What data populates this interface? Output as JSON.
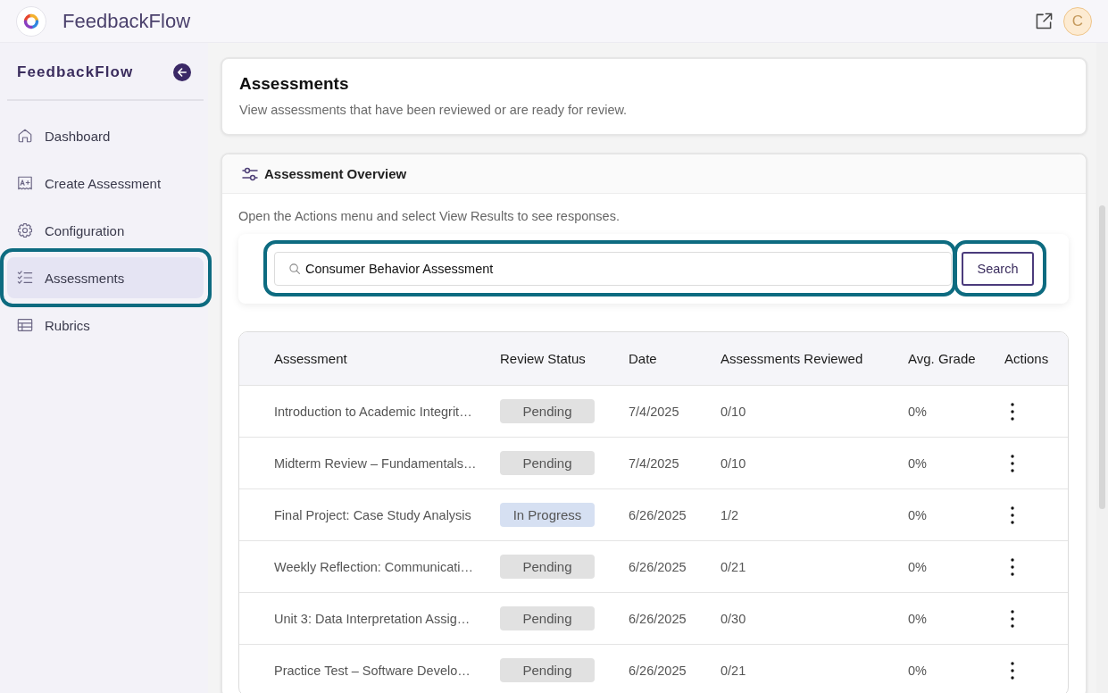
{
  "app_bar": {
    "title": "FeedbackFlow",
    "avatar_initial": "C"
  },
  "sidebar": {
    "title": "FeedbackFlow",
    "items": [
      {
        "label": "Dashboard",
        "kind": "home",
        "selected": false,
        "highlighted": false
      },
      {
        "label": "Create Assessment",
        "kind": "grade",
        "selected": false,
        "highlighted": false
      },
      {
        "label": "Configuration",
        "kind": "gear",
        "selected": false,
        "highlighted": false
      },
      {
        "label": "Assessments",
        "kind": "checklist",
        "selected": true,
        "highlighted": true
      },
      {
        "label": "Rubrics",
        "kind": "table",
        "selected": false,
        "highlighted": false
      }
    ]
  },
  "page_header": {
    "title": "Assessments",
    "subtitle": "View assessments that have been reviewed or are ready for review."
  },
  "overview": {
    "title": "Assessment Overview",
    "hint": "Open the Actions menu and select View Results to see responses.",
    "search": {
      "value": "Consumer Behavior Assessment",
      "highlighted": true
    },
    "search_button": {
      "label": "Search",
      "highlighted": true
    },
    "table": {
      "columns": [
        "Assessment",
        "Review Status",
        "Date",
        "Assessments Reviewed",
        "Avg. Grade",
        "Actions"
      ],
      "rows": [
        {
          "assessment": "Introduction to Academic Integrit…",
          "status": {
            "label": "Pending",
            "kind": "pending"
          },
          "date": "7/4/2025",
          "reviewed": "0/10",
          "avg_grade": "0%"
        },
        {
          "assessment": "Midterm Review – Fundamentals…",
          "status": {
            "label": "Pending",
            "kind": "pending"
          },
          "date": "7/4/2025",
          "reviewed": "0/10",
          "avg_grade": "0%"
        },
        {
          "assessment": "Final Project: Case Study Analysis",
          "status": {
            "label": "In Progress",
            "kind": "in_progress"
          },
          "date": "6/26/2025",
          "reviewed": "1/2",
          "avg_grade": "0%"
        },
        {
          "assessment": "Weekly Reflection: Communicati…",
          "status": {
            "label": "Pending",
            "kind": "pending"
          },
          "date": "6/26/2025",
          "reviewed": "0/21",
          "avg_grade": "0%"
        },
        {
          "assessment": "Unit 3: Data Interpretation Assig…",
          "status": {
            "label": "Pending",
            "kind": "pending"
          },
          "date": "6/26/2025",
          "reviewed": "0/30",
          "avg_grade": "0%"
        },
        {
          "assessment": "Practice Test – Software Develo…",
          "status": {
            "label": "Pending",
            "kind": "pending"
          },
          "date": "6/26/2025",
          "reviewed": "0/21",
          "avg_grade": "0%"
        }
      ]
    }
  }
}
